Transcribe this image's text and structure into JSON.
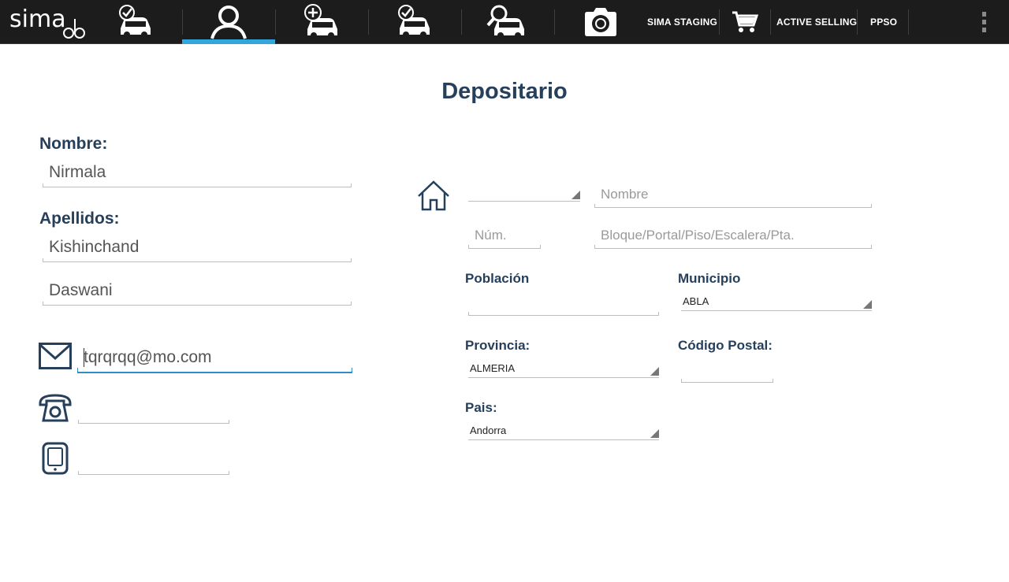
{
  "topbar": {
    "logo_text": "sima",
    "nav": [
      {
        "icon": "car-check-icon"
      },
      {
        "icon": "user-icon",
        "active": true
      },
      {
        "icon": "car-add-icon"
      },
      {
        "icon": "car-verified-icon"
      },
      {
        "icon": "car-search-icon"
      },
      {
        "icon": "camera-icon"
      }
    ],
    "sima_staging_label": "SIMA STAGING",
    "cart_icon": "cart-icon",
    "active_selling_label": "ACTIVE SELLING",
    "ppso_label": "PPSO",
    "overflow_icon": "overflow-menu-icon",
    "accent_color": "#33a5dd"
  },
  "page": {
    "title": "Depositario",
    "label_color": "#26405c"
  },
  "left": {
    "nombre_label": "Nombre:",
    "nombre_value": "Nirmala",
    "apellidos_label": "Apellidos:",
    "apellido1_value": "Kishinchand",
    "apellido2_value": "Daswani",
    "email_value": "tqrqrqq@mo.com",
    "phone_value": "",
    "mobile_value": ""
  },
  "address": {
    "home_icon": "home-icon",
    "via_type_value": "",
    "nombre_placeholder": "Nombre",
    "num_placeholder": "Núm.",
    "bloque_placeholder": "Bloque/Portal/Piso/Escalera/Pta.",
    "poblacion_label": "Población",
    "poblacion_value": "",
    "municipio_label": "Municipio",
    "municipio_value": "ABLA",
    "provincia_label": "Provincia:",
    "provincia_value": "ALMERIA",
    "cp_label": "Código Postal:",
    "cp_value": "",
    "pais_label": "Pais:",
    "pais_value": "Andorra"
  }
}
